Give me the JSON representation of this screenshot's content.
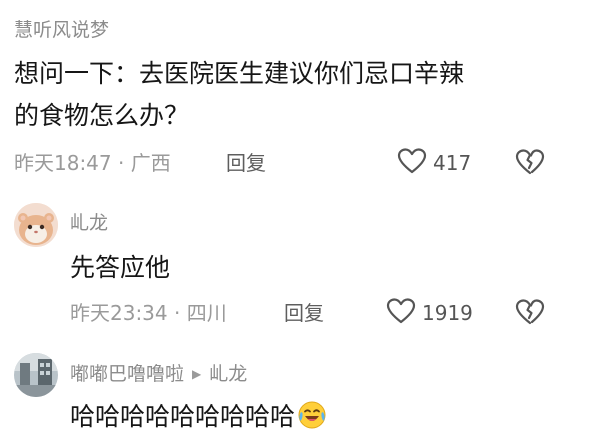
{
  "comments": [
    {
      "username": "慧听风说梦",
      "text_line1": "想问一下：去医院医生建议你们忌口辛辣",
      "text_line2": "的食物怎么办？",
      "meta": "昨天18:47 · 广西",
      "reply_label": "回复",
      "likes": "417"
    },
    {
      "username": "乢龙",
      "text": "先答应他",
      "meta": "昨天23:34 · 四川",
      "reply_label": "回复",
      "likes": "1919"
    },
    {
      "username": "嘟嘟巴噜噜啦",
      "reply_to": "乢龙",
      "text": "哈哈哈哈哈哈哈哈哈"
    }
  ],
  "icons": {
    "like": "heart-outline-icon",
    "dislike": "broken-heart-icon",
    "reply_arrow": "triangle-right-icon",
    "emoji": "laughing-crying-emoji"
  },
  "colors": {
    "text": "#161616",
    "username": "#8c8c8c",
    "meta": "#9a9a9a"
  }
}
